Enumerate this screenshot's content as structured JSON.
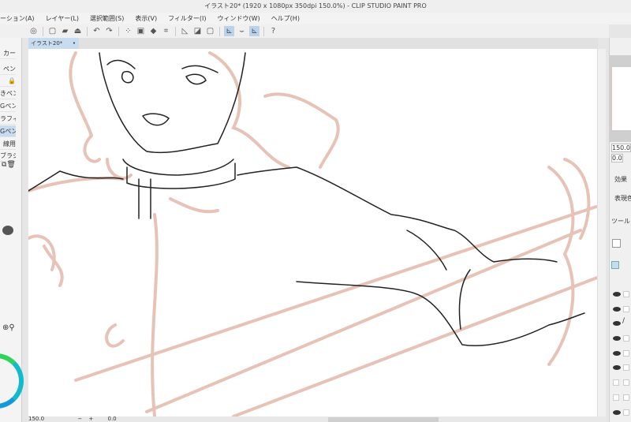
{
  "window": {
    "title": "イラスト20* (1920 x 1080px 350dpi 150.0%)  - CLIP STUDIO PAINT PRO"
  },
  "menu": [
    "ーション(A)",
    "レイヤー(L)",
    "選択範囲(S)",
    "表示(V)",
    "フィルター(I)",
    "ウィンドウ(W)",
    "ヘルプ(H)"
  ],
  "document_tab": {
    "label": "イラスト20*",
    "modified_dot": "•"
  },
  "left_panel": {
    "header": "カー",
    "items": [
      "ペン",
      "",
      "きペン",
      "Gペン",
      "ラフィ",
      "Gペン",
      "線用",
      "ブラシ"
    ],
    "selected_index": 5
  },
  "right_panel": {
    "zoom": "150.0",
    "rotation": "0.0",
    "effect_label": "効果",
    "color_expression_label": "表現色",
    "tool_property_label": "ツールプ"
  },
  "status": {
    "zoom": "150.0",
    "angle": "0.0"
  },
  "colors": {
    "sketch": "#e6c3b6",
    "lineart": "#222222",
    "selected": "#c8dcef"
  }
}
